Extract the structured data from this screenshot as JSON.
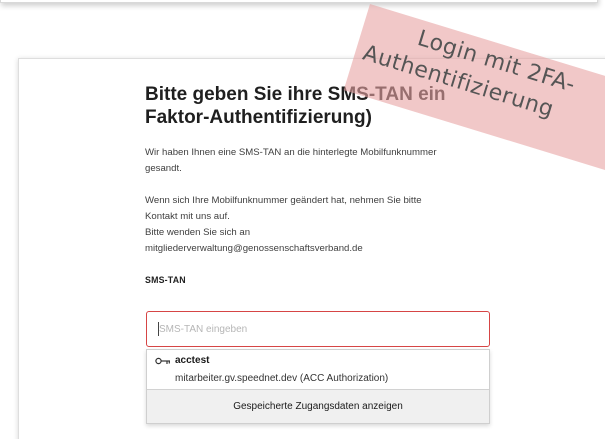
{
  "page": {
    "heading_lines": [
      "Bitte geben Sie ihre SMS-TAN ein",
      "Faktor-Authentifizierung)"
    ],
    "paragraph1_lines": [
      "Wir haben Ihnen eine SMS-TAN an die hinterlegte Mobilfunknummer",
      "gesandt."
    ],
    "paragraph2_lines": [
      "Wenn sich Ihre Mobilfunknummer geändert hat, nehmen Sie bitte",
      "Kontakt mit uns auf.",
      "Bitte wenden Sie sich an",
      "mitgliederverwaltung@genossenschaftsverband.de"
    ]
  },
  "tan_field": {
    "label": "SMS-TAN",
    "placeholder": "SMS-TAN eingeben",
    "value": ""
  },
  "autofill": {
    "icon": "key-icon",
    "username": "acctest",
    "site": "mitarbeiter.gv.speednet.dev (ACC Authorization)",
    "show_saved_label": "Gespeicherte Zugangsdaten anzeigen"
  },
  "banner": {
    "line1": "Login mit 2FA-",
    "line2": "Authentifizierung",
    "color": "#e7a4a4"
  }
}
